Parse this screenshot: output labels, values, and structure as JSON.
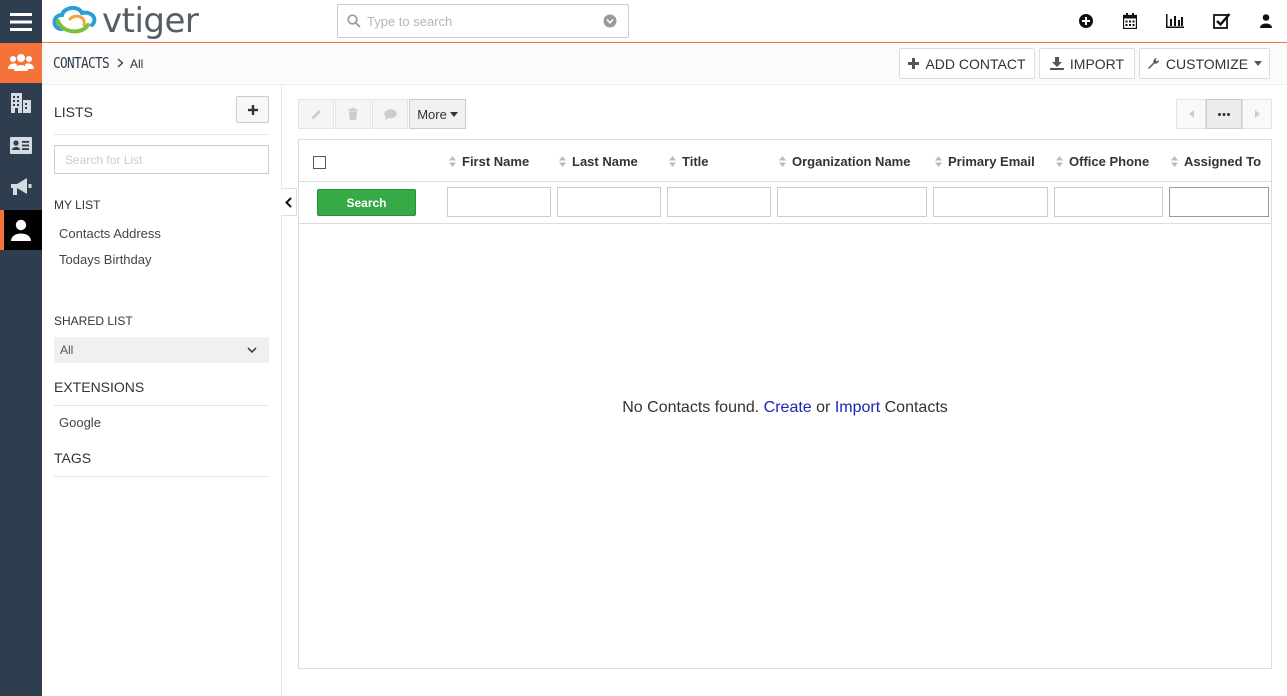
{
  "app": {
    "logo_text": "vtiger",
    "search_placeholder": "Type to search"
  },
  "topbar_icons": [
    "plus-circle-icon",
    "calendar-icon",
    "bar-chart-icon",
    "checkbox-tasks-icon",
    "user-icon"
  ],
  "rail": {
    "items": [
      "contacts-group-icon",
      "organizations-icon",
      "contact-card-icon",
      "megaphone-icon",
      "person-icon"
    ],
    "active_color": "#f3733a",
    "selected_color": "#000000"
  },
  "module": {
    "name": "CONTACTS",
    "separator": ">",
    "view": "All",
    "buttons": {
      "add": "ADD CONTACT",
      "import": "IMPORT",
      "customize": "CUSTOMIZE"
    }
  },
  "sidebar": {
    "lists_title": "LISTS",
    "add_list_label": "+",
    "search_placeholder": "Search for List",
    "my_list_title": "MY LIST",
    "my_list_items": [
      "Contacts Address",
      "Todays Birthday"
    ],
    "shared_list_title": "SHARED LIST",
    "shared_list_selected": "All",
    "extensions_title": "EXTENSIONS",
    "extensions_items": [
      "Google"
    ],
    "tags_title": "TAGS"
  },
  "toolbar": {
    "more_label": "More"
  },
  "grid": {
    "columns": [
      "First Name",
      "Last Name",
      "Title",
      "Organization Name",
      "Primary Email",
      "Office Phone",
      "Assigned To"
    ],
    "search_label": "Search",
    "empty": {
      "prefix": "No Contacts found.",
      "create": "Create",
      "or": "or",
      "import": "Import",
      "suffix": "Contacts"
    }
  },
  "colors": {
    "rail_bg": "#2f3e4e",
    "accent": "#f3733a",
    "search_green": "#35aa47",
    "link_blue": "#1a24b5"
  }
}
